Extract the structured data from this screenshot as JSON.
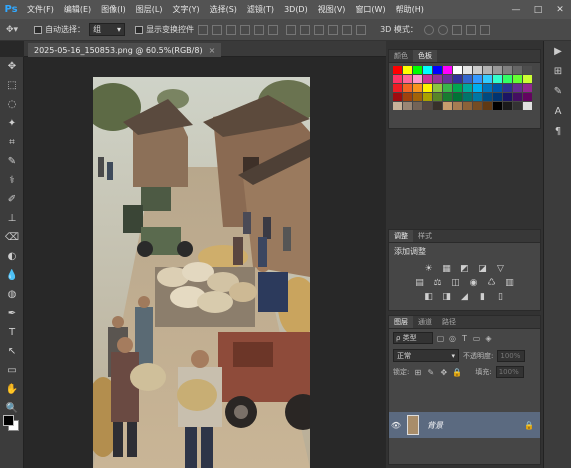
{
  "app": {
    "logo": "Ps"
  },
  "menu": [
    "文件(F)",
    "编辑(E)",
    "图像(I)",
    "图层(L)",
    "文字(Y)",
    "选择(S)",
    "滤镜(T)",
    "3D(D)",
    "视图(V)",
    "窗口(W)",
    "帮助(H)"
  ],
  "window_controls": {
    "minimize": "—",
    "maximize": "□",
    "close": "✕"
  },
  "options": {
    "auto_select_label": "自动选择：",
    "auto_select_value": "组",
    "show_transform_label": "显示变换控件",
    "mode_3d_label": "3D 模式："
  },
  "document": {
    "tab_title": "2025-05-16_150853.png @ 60.5%(RGB/8)",
    "close": "×"
  },
  "swatches_panel": {
    "tabs": [
      "颜色",
      "色板"
    ],
    "colors": [
      "#ff0000",
      "#ffff00",
      "#00ff00",
      "#00ffff",
      "#0000ff",
      "#ff00ff",
      "#ffffff",
      "#e6e6e6",
      "#cccccc",
      "#b3b3b3",
      "#999999",
      "#808080",
      "#666666",
      "#4d4d4d",
      "#ff3366",
      "#ff6699",
      "#ff99cc",
      "#cc3399",
      "#993399",
      "#663399",
      "#333399",
      "#3366cc",
      "#3399ff",
      "#33ccff",
      "#33ffcc",
      "#33ff66",
      "#66ff33",
      "#ccff33",
      "#ed1c24",
      "#f26522",
      "#f7941d",
      "#fff200",
      "#8dc63f",
      "#39b54a",
      "#00a651",
      "#00a99d",
      "#00aeef",
      "#0072bc",
      "#0054a6",
      "#2e3192",
      "#662d91",
      "#92278f",
      "#9e0b0f",
      "#a0410d",
      "#a36209",
      "#aba000",
      "#598527",
      "#197b30",
      "#007236",
      "#00746b",
      "#0076a3",
      "#004a80",
      "#003471",
      "#1b1464",
      "#440e62",
      "#630460",
      "#c7b299",
      "#998675",
      "#736357",
      "#534741",
      "#37302a",
      "#c69c6d",
      "#a67c52",
      "#8c6239",
      "#754c24",
      "#603913",
      "#000000",
      "#1a1a1a",
      "#333333",
      "#e0e0e0"
    ]
  },
  "adjustments_panel": {
    "tabs": [
      "调整",
      "样式"
    ],
    "title": "添加调整",
    "row1": [
      "☀",
      "▦",
      "◩",
      "◪",
      "▽"
    ],
    "row2": [
      "▤",
      "⚖",
      "◫",
      "◉",
      "♺",
      "▥"
    ],
    "row3": [
      "◧",
      "◨",
      "◢",
      "▮",
      "▯"
    ]
  },
  "layers_panel": {
    "tabs": [
      "图层",
      "通道",
      "路径"
    ],
    "filter_kind": "ρ 类型",
    "filter_icons": [
      "▢",
      "◎",
      "T",
      "▭",
      "◈"
    ],
    "blend_mode": "正常",
    "opacity_label": "不透明度:",
    "opacity_value": "100%",
    "lock_label": "锁定:",
    "lock_icons": [
      "⊞",
      "✎",
      "✥",
      "🔒"
    ],
    "fill_label": "填充:",
    "fill_value": "100%",
    "layer": {
      "name": "背景",
      "eye": "👁",
      "lock": "🔒"
    }
  },
  "side_strip_icons": [
    "▶",
    "⊞",
    "✎",
    "A",
    "¶"
  ],
  "tools": [
    "✥",
    "⬚",
    "◌",
    "✦",
    "⌗",
    "✎",
    "⚕",
    "✐",
    "⊥",
    "⌫",
    "◐",
    "💧",
    "◍",
    "✒",
    "T",
    "↖",
    "▭",
    "✋",
    "🔍"
  ]
}
